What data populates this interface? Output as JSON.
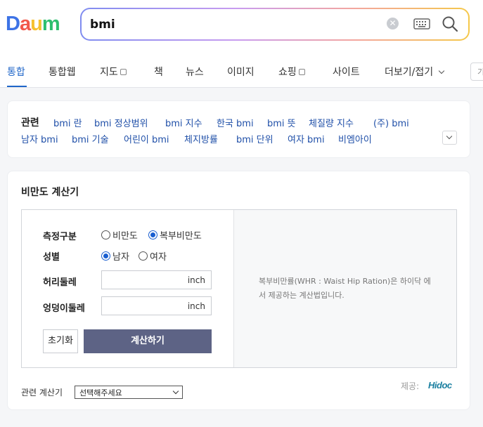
{
  "header": {
    "logo_letters": [
      "D",
      "a",
      "u",
      "m"
    ],
    "logo_colors": [
      "#3d73e6",
      "#f2584a",
      "#f5c12f",
      "#2dbf6e"
    ],
    "search_value": "bmi",
    "clear_icon": "clear-icon",
    "keyboard_icon": "keyboard-icon",
    "search_icon": "search-icon"
  },
  "tabs": [
    {
      "label": "통합",
      "active": true
    },
    {
      "label": "통합웹"
    },
    {
      "label": "지도"
    },
    {
      "label": "책"
    },
    {
      "label": "뉴스"
    },
    {
      "label": "이미지"
    },
    {
      "label": "쇼핑"
    },
    {
      "label": "사이트"
    },
    {
      "label": "더보기/접기"
    }
  ],
  "tab_extra": "기",
  "related": {
    "title": "관련",
    "items": [
      "bmi 란",
      "bmi 정상범위",
      "bmi 지수",
      "한국 bmi",
      "bmi 뜻",
      "체질량 지수",
      "(주) bmi",
      "남자 bmi",
      "bmi 기술",
      "어린이 bmi",
      "체지방률",
      "bmi 단위",
      "여자 bmi",
      "비엠아이"
    ]
  },
  "calculator": {
    "title": "비만도 계산기",
    "measure_label": "측정구분",
    "measure_options": [
      "비만도",
      "복부비만도"
    ],
    "measure_selected": "복부비만도",
    "gender_label": "성별",
    "gender_options": [
      "남자",
      "여자"
    ],
    "gender_selected": "남자",
    "waist_label": "허리둘레",
    "waist_unit": "inch",
    "hip_label": "엉덩이둘레",
    "hip_unit": "inch",
    "reset_label": "초기화",
    "calc_label": "계산하기",
    "info_text": "복부비만률(WHR : Waist Hip Ration)은 하이닥 에서 제공하는 계산법입니다.",
    "related_calc_label": "관련 계산기",
    "select_value": "선택해주세요",
    "provider_label": "제공:",
    "provider_name": "Hidoc"
  }
}
